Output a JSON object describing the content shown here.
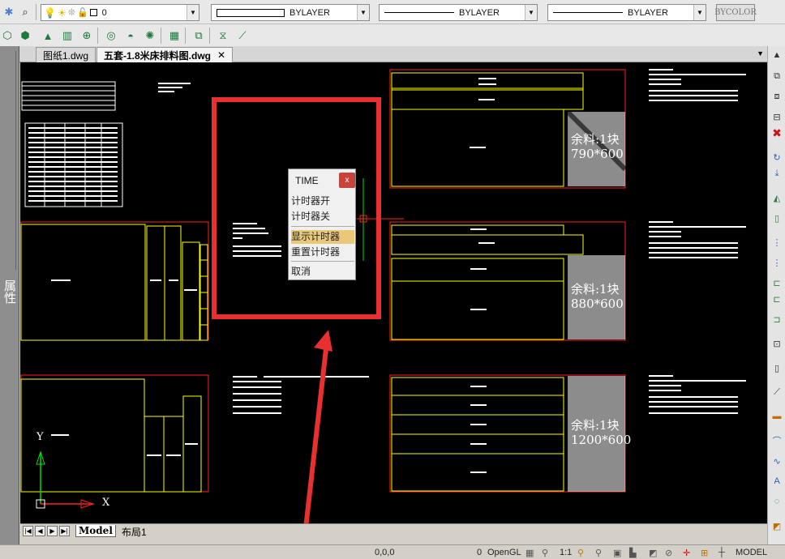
{
  "toolbar": {
    "layer_value": "0",
    "color_value": "BYLAYER",
    "linetype_value": "BYLAYER",
    "lineweight_value": "BYLAYER",
    "plotstyle_value": "BYCOLOR"
  },
  "tabs": [
    {
      "label": "图纸1.dwg"
    },
    {
      "label": "五套-1.8米床排料图.dwg"
    }
  ],
  "left_palette": {
    "label": "属性"
  },
  "dialog": {
    "title": "TIME",
    "close": "x",
    "items": [
      "计时器开",
      "计时器关",
      "显示计时器",
      "重置计时器",
      "取消"
    ]
  },
  "drawing": {
    "remnants": [
      {
        "line1": "余料:1块",
        "line2": "790*600"
      },
      {
        "line1": "余料:1块",
        "line2": "880*600"
      },
      {
        "line1": "余料:1块",
        "line2": "1200*600"
      }
    ],
    "ucs_y": "Y",
    "ucs_x": "X"
  },
  "layout_tabs": [
    "Model",
    "布局1"
  ],
  "status": {
    "coords": "0,0,0",
    "count": "0",
    "renderer": "OpenGL",
    "scale": "1:1",
    "space": "MODEL"
  },
  "colors": {
    "canvas": "#000000",
    "annotation_red": "#e83030",
    "cad_red": "#ff2020",
    "cad_yellow": "#ffff00",
    "highlight": "#e9c879"
  }
}
